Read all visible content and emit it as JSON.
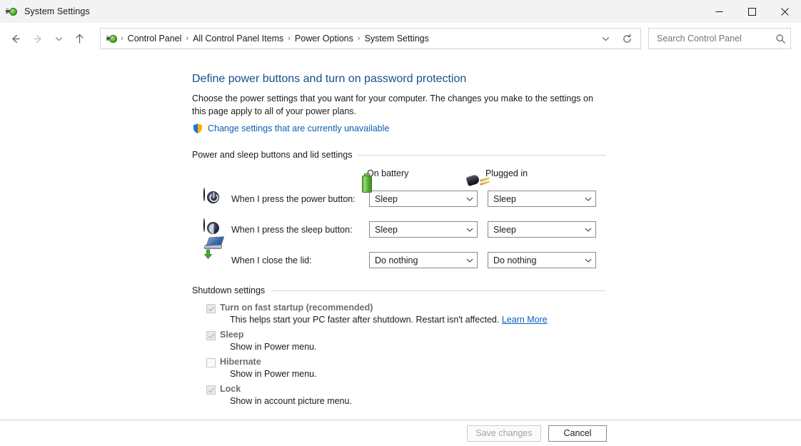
{
  "window": {
    "title": "System Settings",
    "icon": "power-plug-icon",
    "controls": {
      "minimize": "minimize-icon",
      "maximize": "maximize-icon",
      "close": "close-icon"
    }
  },
  "nav": {
    "back": "back-arrow-icon",
    "forward": "forward-arrow-icon",
    "recent": "chevron-down-icon",
    "up": "up-arrow-icon",
    "address_icon": "power-plug-icon",
    "breadcrumbs": [
      "Control Panel",
      "All Control Panel Items",
      "Power Options",
      "System Settings"
    ],
    "separator": "›",
    "dropdown_icon": "chevron-down-icon",
    "refresh_icon": "refresh-icon"
  },
  "search": {
    "placeholder": "Search Control Panel",
    "value": "",
    "icon": "search-icon"
  },
  "page": {
    "title": "Define power buttons and turn on password protection",
    "description": "Choose the power settings that you want for your computer. The changes you make to the settings on this page apply to all of your power plans.",
    "uac_link": "Change settings that are currently unavailable",
    "uac_icon": "uac-shield-icon"
  },
  "power_section": {
    "heading": "Power and sleep buttons and lid settings",
    "columns": [
      {
        "label": "On battery",
        "icon": "battery-icon"
      },
      {
        "label": "Plugged in",
        "icon": "ac-plug-icon"
      }
    ],
    "rows": [
      {
        "label": "When I press the power button:",
        "icon": "power-button-icon",
        "on_battery": "Sleep",
        "plugged_in": "Sleep"
      },
      {
        "label": "When I press the sleep button:",
        "icon": "sleep-button-icon",
        "on_battery": "Sleep",
        "plugged_in": "Sleep"
      },
      {
        "label": "When I close the lid:",
        "icon": "laptop-lid-icon",
        "on_battery": "Do nothing",
        "plugged_in": "Do nothing"
      }
    ]
  },
  "shutdown_section": {
    "heading": "Shutdown settings",
    "items": [
      {
        "label": "Turn on fast startup (recommended)",
        "checked": true,
        "description": "This helps start your PC faster after shutdown. Restart isn't affected.",
        "link": "Learn More"
      },
      {
        "label": "Sleep",
        "checked": true,
        "description": "Show in Power menu.",
        "link": ""
      },
      {
        "label": "Hibernate",
        "checked": false,
        "description": "Show in Power menu.",
        "link": ""
      },
      {
        "label": "Lock",
        "checked": true,
        "description": "Show in account picture menu.",
        "link": ""
      }
    ]
  },
  "footer": {
    "save_label": "Save changes",
    "save_enabled": false,
    "cancel_label": "Cancel"
  },
  "colors": {
    "titlebar": "#f3f3f3",
    "heading_blue": "#1a4d8f",
    "link_blue": "#0a5fb4",
    "text": "#1b1b1b",
    "disabled_text": "#a3a3a3",
    "border": "#d4d4d4"
  }
}
